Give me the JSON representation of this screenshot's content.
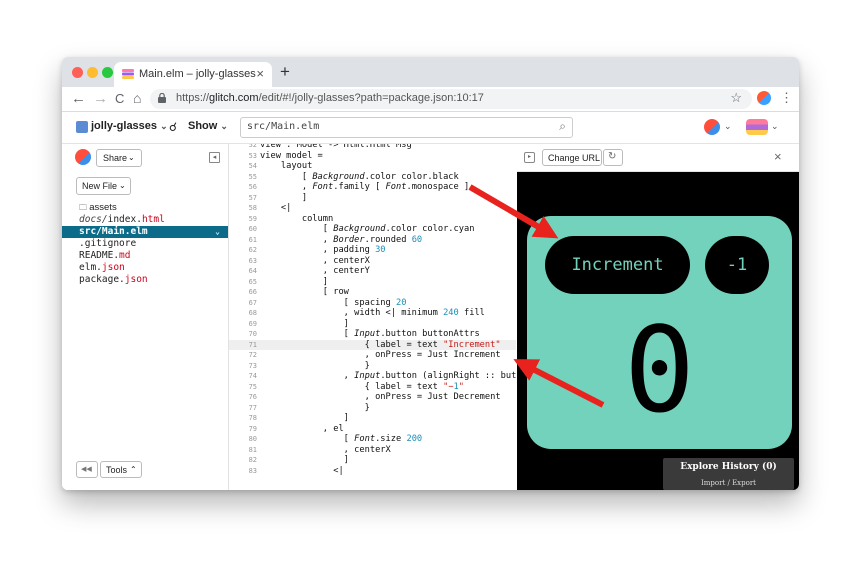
{
  "browser": {
    "tab_title": "Main.elm – jolly-glasses",
    "tab_close": "×",
    "new_tab": "+",
    "url_prefix": "https://",
    "url_domain": "glitch.com",
    "url_rest": "/edit/#!/jolly-glasses?path=package.json:10:17",
    "back": "←",
    "forward": "→",
    "reload": "C",
    "home": "⌂",
    "star": "☆",
    "menu": "⋮"
  },
  "header": {
    "project_name": "jolly-glasses",
    "show_label": "Show",
    "show_icon": "☌",
    "file_path": "src/Main.elm",
    "caret": "⌄",
    "search_icon": "⌕"
  },
  "sidebar": {
    "share_label": "Share",
    "new_file_label": "New File",
    "tools_label": "Tools",
    "rewind_label": "◀◀",
    "files": [
      {
        "name": "assets",
        "kind": "folder"
      },
      {
        "dir": "docs/",
        "base": "index.",
        "ext": "html"
      },
      {
        "base": "src/Main.elm",
        "selected": true
      },
      {
        "base": ".gitignore"
      },
      {
        "base": "README.",
        "ext": "md"
      },
      {
        "base": "elm.",
        "ext": "json"
      },
      {
        "base": "package.",
        "ext": "json"
      }
    ]
  },
  "editor": {
    "lines": [
      {
        "n": "52",
        "t": "view : Model -> Html.Html Msg"
      },
      {
        "n": "53",
        "t": "view model ="
      },
      {
        "n": "54",
        "t": "    layout"
      },
      {
        "n": "55",
        "t": "        [ Background.color color.black"
      },
      {
        "n": "56",
        "t": "        , Font.family [ Font.monospace ]"
      },
      {
        "n": "57",
        "t": "        ]"
      },
      {
        "n": "58",
        "t": "    <|"
      },
      {
        "n": "59",
        "t": "        column"
      },
      {
        "n": "60",
        "t": "            [ Background.color color.cyan"
      },
      {
        "n": "61",
        "t": "            , Border.rounded 60"
      },
      {
        "n": "62",
        "t": "            , padding 30"
      },
      {
        "n": "63",
        "t": "            , centerX"
      },
      {
        "n": "64",
        "t": "            , centerY"
      },
      {
        "n": "65",
        "t": "            ]"
      },
      {
        "n": "66",
        "t": "            [ row"
      },
      {
        "n": "67",
        "t": "                [ spacing 20"
      },
      {
        "n": "68",
        "t": "                , width <| minimum 240 fill"
      },
      {
        "n": "69",
        "t": "                ]"
      },
      {
        "n": "70",
        "t": "                [ Input.button buttonAttrs"
      },
      {
        "n": "71",
        "t": "                    { label = text \"Increment\""
      },
      {
        "n": "72",
        "t": "                    , onPress = Just Increment"
      },
      {
        "n": "73",
        "t": "                    }"
      },
      {
        "n": "74",
        "t": "                , Input.button (alignRight :: butt"
      },
      {
        "n": "75",
        "t": "                    { label = text \"−1\""
      },
      {
        "n": "76",
        "t": "                    , onPress = Just Decrement"
      },
      {
        "n": "77",
        "t": "                    }"
      },
      {
        "n": "78",
        "t": "                ]"
      },
      {
        "n": "79",
        "t": "            , el"
      },
      {
        "n": "80",
        "t": "                [ Font.size 200"
      },
      {
        "n": "81",
        "t": "                , centerX"
      },
      {
        "n": "82",
        "t": "                ]"
      },
      {
        "n": "83",
        "t": "              <|"
      }
    ]
  },
  "preview": {
    "change_url_label": "Change URL",
    "refresh_icon": "↻",
    "close": "×",
    "increment_label": "Increment",
    "decrement_label": "-1",
    "count": "0",
    "explore_history": "Explore History (0)",
    "import_export": "Import / Export"
  },
  "colors": {
    "accent_teal": "#72d2bb",
    "annotation_arrow": "#e8231e",
    "selected_file": "#0d6b8a"
  }
}
